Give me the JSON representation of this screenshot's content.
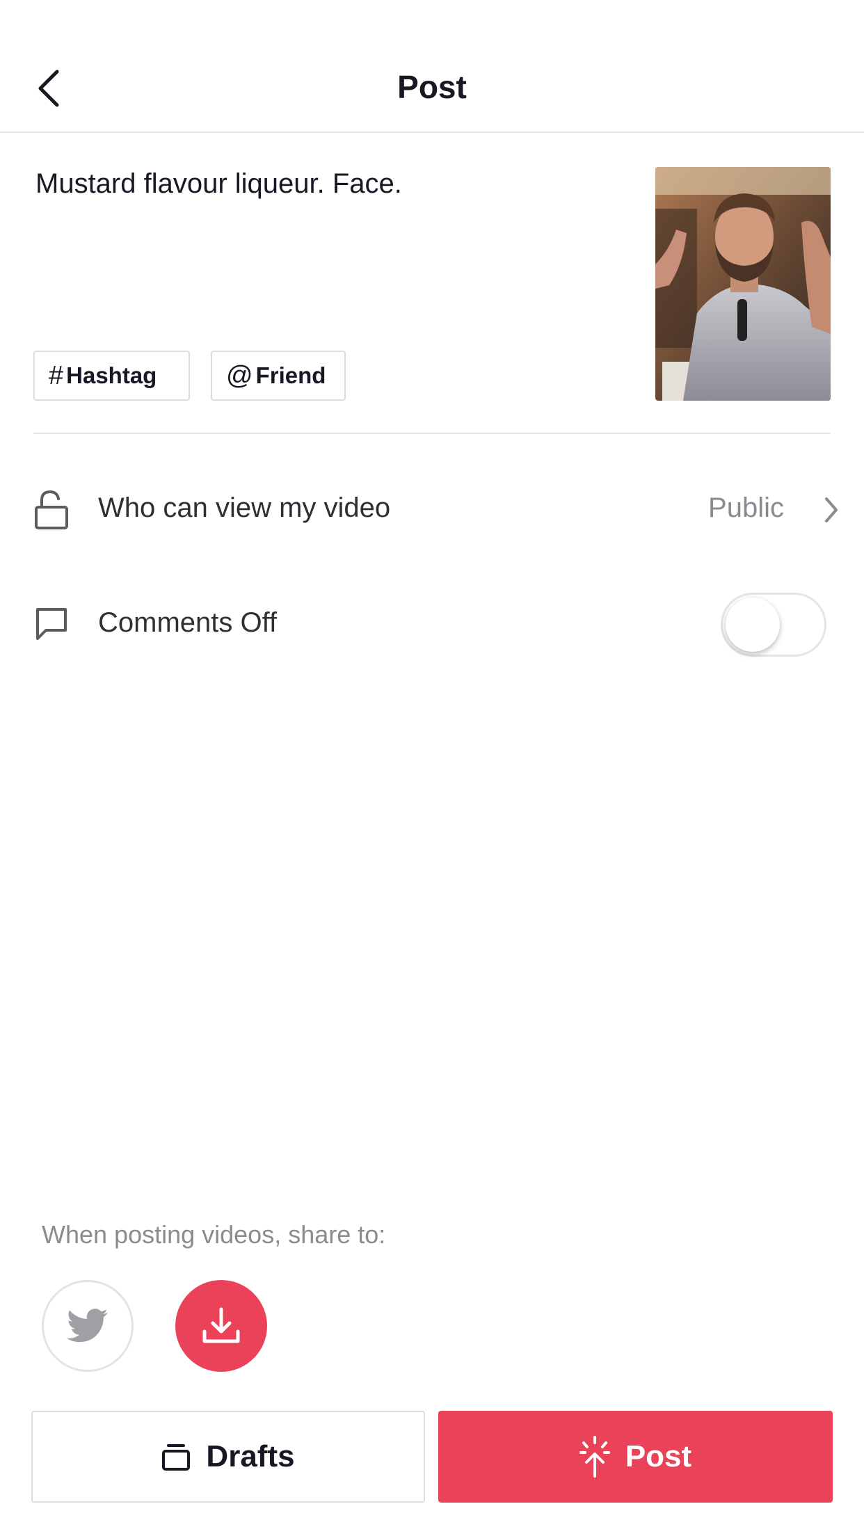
{
  "header": {
    "title": "Post",
    "back_icon": "chevron-left-icon"
  },
  "caption": {
    "text": "Mustard flavour liqueur. Face."
  },
  "chips": {
    "hashtag": {
      "glyph": "#",
      "label": "Hashtag"
    },
    "friend": {
      "glyph": "@",
      "label": "Friend"
    }
  },
  "thumbnail": {
    "icon": "video-thumbnail"
  },
  "settings": {
    "view": {
      "label": "Who can view my video",
      "value": "Public",
      "icon": "unlock-icon"
    },
    "comments": {
      "label": "Comments Off",
      "icon": "comment-icon",
      "enabled": false
    }
  },
  "share": {
    "label": "When posting videos, share to:",
    "targets": [
      {
        "name": "twitter",
        "icon": "twitter-icon",
        "selected": false
      },
      {
        "name": "save",
        "icon": "download-icon",
        "selected": true
      }
    ]
  },
  "actions": {
    "drafts_label": "Drafts",
    "post_label": "Post"
  },
  "colors": {
    "accent": "#ea4359",
    "text_primary": "#161823",
    "text_secondary": "#8a8b91",
    "border": "#dcdcdf"
  }
}
